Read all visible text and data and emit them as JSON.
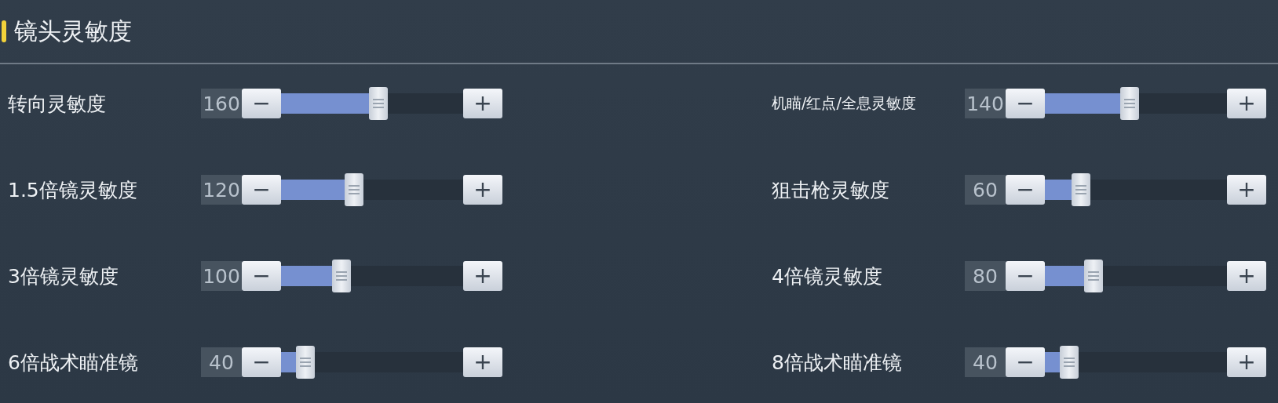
{
  "section": {
    "title": "镜头灵敏度"
  },
  "settings": [
    {
      "label": "转向灵敏度",
      "value": "160",
      "level": 0.533,
      "minus": "−",
      "plus": "+"
    },
    {
      "label": "机瞄/红点/全息灵敏度",
      "value": "140",
      "level": 0.467,
      "minus": "−",
      "plus": "+"
    },
    {
      "label": "1.5倍镜灵敏度",
      "value": "120",
      "level": 0.4,
      "minus": "−",
      "plus": "+"
    },
    {
      "label": "狙击枪灵敏度",
      "value": "60",
      "level": 0.2,
      "minus": "−",
      "plus": "+"
    },
    {
      "label": "3倍镜灵敏度",
      "value": "100",
      "level": 0.333,
      "minus": "−",
      "plus": "+"
    },
    {
      "label": "4倍镜灵敏度",
      "value": "80",
      "level": 0.267,
      "minus": "−",
      "plus": "+"
    },
    {
      "label": "6倍战术瞄准镜",
      "value": "40",
      "level": 0.133,
      "minus": "−",
      "plus": "+"
    },
    {
      "label": "8倍战术瞄准镜",
      "value": "40",
      "level": 0.133,
      "minus": "−",
      "plus": "+"
    }
  ]
}
